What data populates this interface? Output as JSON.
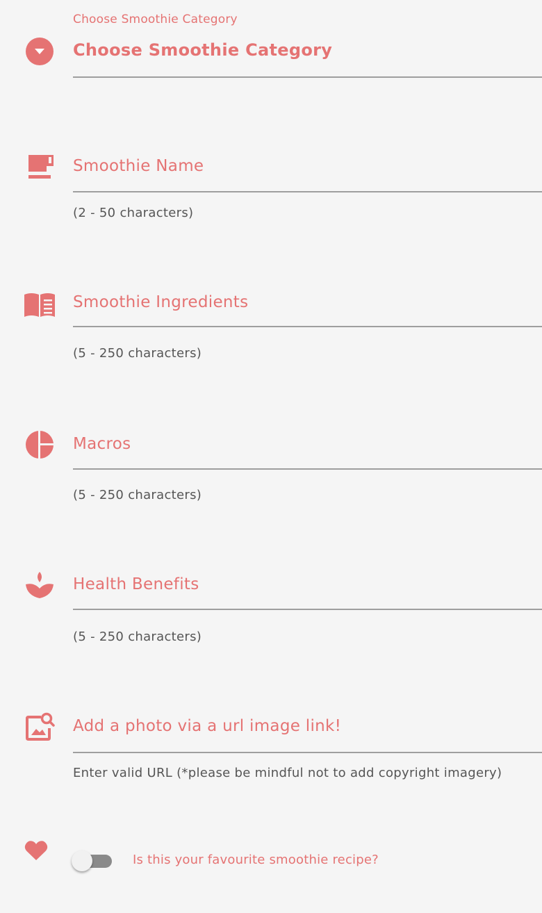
{
  "colors": {
    "accent": "#e57373",
    "background": "#f5f5f5",
    "underline": "#9e9e9e",
    "helper_text": "#555555",
    "switch_track": "#8a8a8a"
  },
  "category": {
    "label": "Choose Smoothie Category",
    "selected": "Choose Smoothie Category",
    "icon": "dropdown-circle-icon"
  },
  "fields": {
    "name": {
      "label": "Smoothie Name",
      "helper": "(2 - 50 characters)",
      "value": "",
      "icon": "coffee-cup-icon"
    },
    "ingredients": {
      "label": "Smoothie Ingredients",
      "helper": "(5 - 250 characters)",
      "value": "",
      "icon": "open-book-icon"
    },
    "macros": {
      "label": "Macros",
      "helper": "(5 - 250 characters)",
      "value": "",
      "icon": "pie-chart-icon"
    },
    "benefits": {
      "label": "Health Benefits",
      "helper": "(5 - 250 characters)",
      "value": "",
      "icon": "spa-lotus-icon"
    },
    "photo": {
      "label": "Add a photo via a url image link!",
      "helper": "Enter valid URL (*please be mindful not to add copyright imagery)",
      "value": "",
      "icon": "image-search-icon"
    }
  },
  "favourite": {
    "label": "Is this your favourite smoothie recipe?",
    "checked": false,
    "icon": "heart-icon"
  }
}
